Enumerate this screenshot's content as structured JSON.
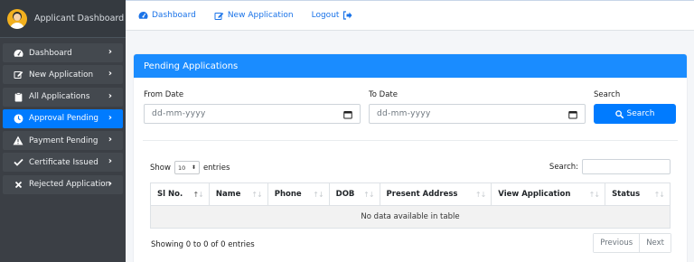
{
  "sidebar": {
    "brand": "Applicant Dashboard",
    "items": [
      {
        "label": "Dashboard",
        "icon": "tachometer-icon"
      },
      {
        "label": "New Application",
        "icon": "edit-icon"
      },
      {
        "label": "All Applications",
        "icon": "clipboard-icon"
      },
      {
        "label": "Approval Pending",
        "icon": "clock-icon",
        "active": true
      },
      {
        "label": "Payment Pending",
        "icon": "warning-icon"
      },
      {
        "label": "Certificate Issued",
        "icon": "check-icon"
      },
      {
        "label": "Rejected Application",
        "icon": "times-icon"
      }
    ]
  },
  "topbar": {
    "links": [
      {
        "label": "Dashboard",
        "icon": "tachometer-icon"
      },
      {
        "label": "New Application",
        "icon": "edit-icon"
      },
      {
        "label": "Logout",
        "icon": "sign-out-icon"
      }
    ]
  },
  "card": {
    "title": "Pending Applications",
    "from_label": "From Date",
    "to_label": "To Date",
    "search_label": "Search",
    "date_placeholder": "dd-mm-yyyy",
    "search_button": "Search"
  },
  "table": {
    "show_label": "Show",
    "length_value": "10",
    "entries_label": "entries",
    "search_label": "Search:",
    "columns": [
      "Sl No.",
      "Name",
      "Phone",
      "DOB",
      "Present Address",
      "View Application",
      "Status"
    ],
    "empty": "No data available in table",
    "info": "Showing 0 to 0 of 0 entries",
    "prev": "Previous",
    "next": "Next"
  },
  "colors": {
    "accent": "#007bff",
    "sidebar_bg": "#3b3f45",
    "header_bg": "#1a8cff"
  }
}
